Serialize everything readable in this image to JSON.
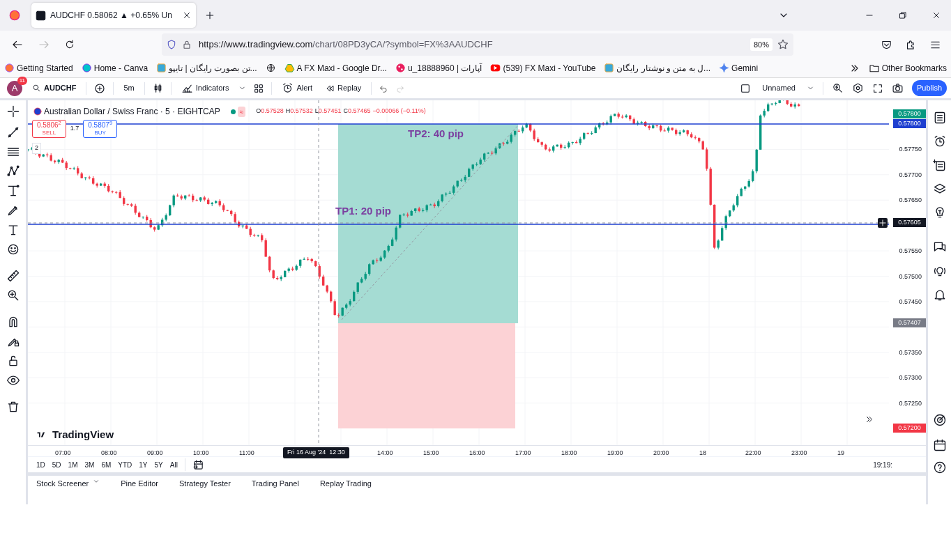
{
  "browser": {
    "tab_title": "AUDCHF 0.58062 ▲ +0.65% Un",
    "url_host": "https://www.tradingview.com",
    "url_path": "/chart/08PD3yCA/?symbol=FX%3AAUDCHF",
    "zoom": "80%",
    "bookmarks": [
      {
        "label": "Getting Started",
        "kind": "firefox"
      },
      {
        "label": "Home - Canva",
        "kind": "canva"
      },
      {
        "label": "...تن بصورت رایگان | تایپو",
        "kind": "app"
      },
      {
        "kind": "globe"
      },
      {
        "label": "A FX Maxi - Google Dr...",
        "kind": "drive"
      },
      {
        "label": "u_18888960 | آپارات",
        "kind": "aparat"
      },
      {
        "label": "(539) FX Maxi - YouTube",
        "kind": "youtube"
      },
      {
        "label": "...ل به متن و نوشتار رایگان",
        "kind": "app"
      },
      {
        "label": "Gemini",
        "kind": "gemini"
      }
    ],
    "other_bookmarks": "Other Bookmarks"
  },
  "toolbar": {
    "avatar": "A",
    "notifications": "11",
    "symbol": "AUDCHF",
    "interval": "5m",
    "indicators": "Indicators",
    "alert": "Alert",
    "replay": "Replay",
    "layout": "Unnamed",
    "publish": "Publish"
  },
  "chart": {
    "title": "Australian Dollar / Swiss Franc · 5 · EIGHTCAP",
    "ohlc": [
      {
        "label": "O",
        "value": "0.57528"
      },
      {
        "label": "H",
        "value": "0.57532"
      },
      {
        "label": "L",
        "value": "0.57451"
      },
      {
        "label": "C",
        "value": "0.57465"
      }
    ],
    "change": "−0.00066 (−0.11%)",
    "market_status": "≈",
    "sell": {
      "price": "0.5806$^{2}$",
      "label": "SELL"
    },
    "spread": "1.7",
    "buy": {
      "price": "0.5807$^{9}$",
      "label": "BUY"
    },
    "indicator_count": "2",
    "annotations": [
      "TP2: 40 pip",
      "TP1: 20 pip"
    ],
    "logo": "TradingView",
    "price_axis": [
      "0.57750",
      "0.57700",
      "0.57650",
      "0.57550",
      "0.57500",
      "0.57450",
      "0.57350",
      "0.57300",
      "0.57250"
    ],
    "price_tags": [
      {
        "value": "0.57800",
        "color": "#089981"
      },
      {
        "value": "0.57800",
        "color": "#1e3fd0"
      },
      {
        "value": "0.57605",
        "color": "#131722"
      },
      {
        "value": "0.57407",
        "color": "#787b86"
      },
      {
        "value": "0.57200",
        "color": "#f23645"
      }
    ],
    "time_axis": [
      "07:00",
      "08:00",
      "09:00",
      "10:00",
      "11:00",
      "14:00",
      "15:00",
      "16:00",
      "17:00",
      "18:00",
      "19:00",
      "20:00",
      "18",
      "22:00",
      "23:00",
      "19"
    ],
    "crosshair_time": "Fri 16 Aug '24  12:30"
  },
  "ranges": [
    "1D",
    "5D",
    "1M",
    "3M",
    "6M",
    "YTD",
    "1Y",
    "5Y",
    "All"
  ],
  "clock": "19:19:",
  "bottom_tabs": [
    "Stock Screener",
    "Pine Editor",
    "Strategy Tester",
    "Trading Panel",
    "Replay Trading"
  ]
}
